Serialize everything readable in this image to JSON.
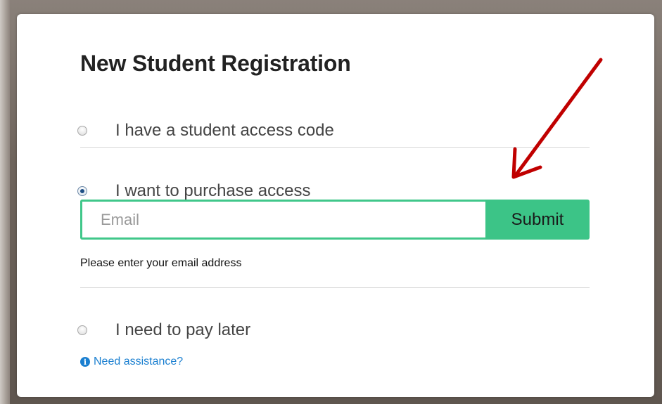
{
  "form": {
    "title": "New Student Registration",
    "options": [
      {
        "label": "I have a student access code",
        "checked": false
      },
      {
        "label": "I want to purchase access",
        "checked": true
      },
      {
        "label": "I need to pay later",
        "checked": false
      }
    ],
    "email": {
      "placeholder": "Email",
      "value": ""
    },
    "submit_label": "Submit",
    "helper_text": "Please enter your email address",
    "assistance_link": "Need assistance?",
    "info_icon_glyph": "i"
  },
  "colors": {
    "accent_green": "#3cc487",
    "link_blue": "#1a7fd0",
    "annotation_arrow": "#c00000"
  },
  "icons": {
    "info": "info-circle-icon",
    "annotation": "arrow-icon"
  }
}
